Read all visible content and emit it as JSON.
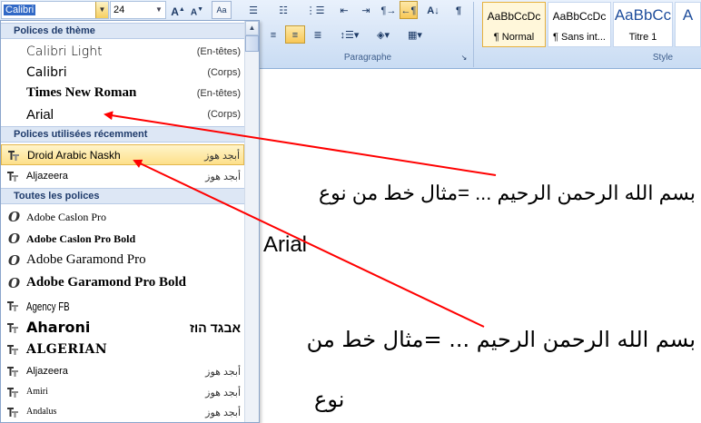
{
  "ribbon": {
    "font_value": "Calibri",
    "size_value": "24",
    "paragraph_label": "Paragraphe",
    "style_label": "Style",
    "styles": [
      {
        "sample": "AaBbCcDc",
        "name": "¶ Normal"
      },
      {
        "sample": "AaBbCcDc",
        "name": "¶ Sans int..."
      },
      {
        "sample": "AaBbCc",
        "name": "Titre 1"
      }
    ]
  },
  "dropdown": {
    "theme_header": "Polices de thème",
    "theme_fonts": [
      {
        "name": "Calibri Light",
        "note": "(En-têtes)"
      },
      {
        "name": "Calibri",
        "note": "(Corps)"
      },
      {
        "name": "Times New Roman",
        "note": "(En-têtes)"
      },
      {
        "name": "Arial",
        "note": "(Corps)"
      }
    ],
    "recent_header": "Polices utilisées récemment",
    "recent_fonts": [
      {
        "name": "Droid Arabic Naskh",
        "note": "أبجد هوز"
      },
      {
        "name": "Aljazeera",
        "note": "أبجد هوز"
      }
    ],
    "all_header": "Toutes les polices",
    "all_fonts": [
      {
        "name": "Adobe Caslon Pro",
        "note": ""
      },
      {
        "name": "Adobe Caslon Pro Bold",
        "note": ""
      },
      {
        "name": "Adobe Garamond Pro",
        "note": ""
      },
      {
        "name": "Adobe Garamond Pro Bold",
        "note": ""
      },
      {
        "name": "Agency FB",
        "note": ""
      },
      {
        "name": "Aharoni",
        "note": "אבגד הוז"
      },
      {
        "name": "ALGERIAN",
        "note": ""
      },
      {
        "name": "Aljazeera",
        "note": "أبجد هوز"
      },
      {
        "name": "Amiri",
        "note": "أبجد هوز"
      },
      {
        "name": "Andalus",
        "note": "أبجد هوز"
      }
    ]
  },
  "document": {
    "line1": "بسم الله الرحمن الرحيم ...   =مثال خط من نوع",
    "line2": "Arial",
    "line3": "بسم الله الرحمن الرحيم ... =مثال خط من",
    "line4": "نوع"
  },
  "colors": {
    "arrow": "#ff0000",
    "highlight": "#fde08a",
    "section_header": "#dde7f5"
  }
}
